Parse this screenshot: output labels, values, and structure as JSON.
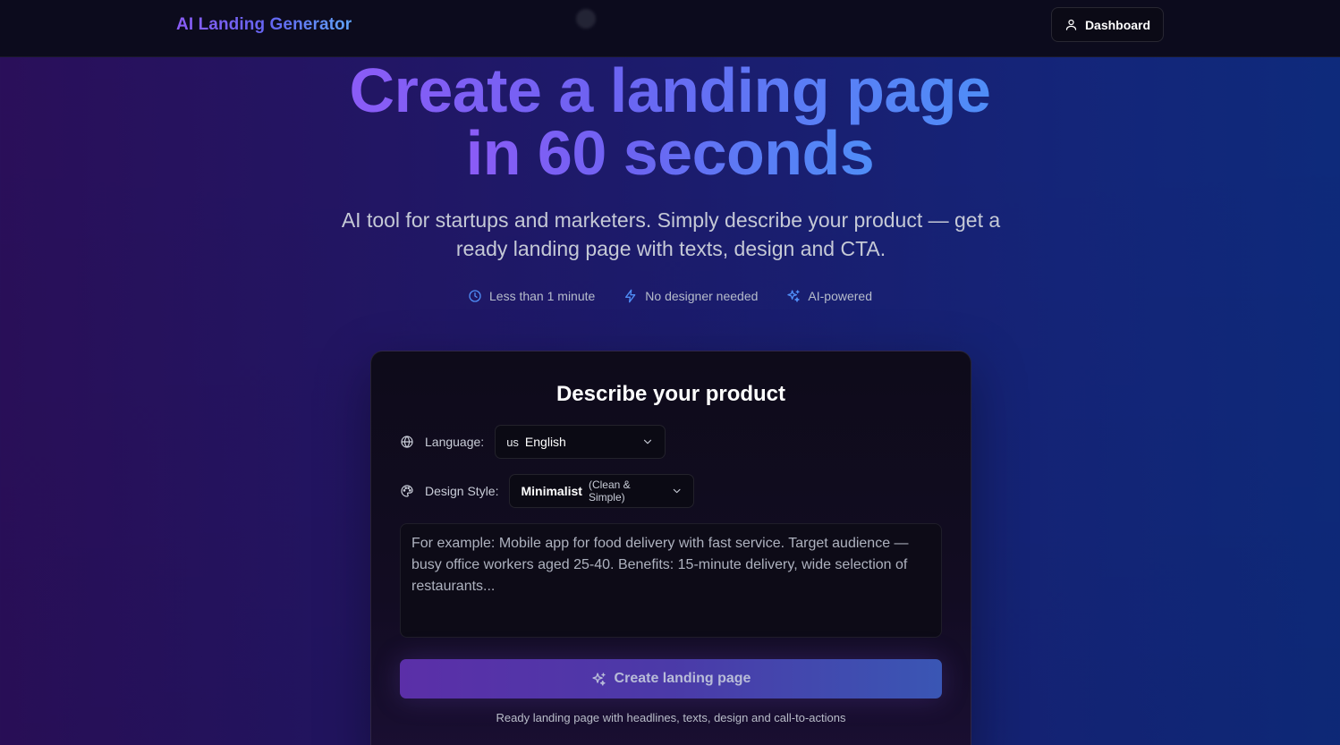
{
  "header": {
    "brand": "AI Landing Generator",
    "dashboard_label": "Dashboard"
  },
  "hero": {
    "title_line1": "Create a landing page",
    "title_line2": "in 60 seconds",
    "subtitle": "AI tool for startups and marketers. Simply describe your product — get a ready landing page with texts, design and CTA.",
    "features": [
      {
        "icon": "clock-icon",
        "label": "Less than 1 minute"
      },
      {
        "icon": "lightning-icon",
        "label": "No designer needed"
      },
      {
        "icon": "sparkles-icon",
        "label": "AI-powered"
      }
    ]
  },
  "form": {
    "title": "Describe your product",
    "language_label": "Language:",
    "language_code": "us",
    "language_value": "English",
    "style_label": "Design Style:",
    "style_value": "Minimalist",
    "style_hint": "(Clean & Simple)",
    "description_placeholder": "For example: Mobile app for food delivery with fast service. Target audience — busy office workers aged 25-40. Benefits: 15-minute delivery, wide selection of restaurants...",
    "description_value": "",
    "submit_label": "Create landing page",
    "submit_note": "Ready landing page with headlines, texts, design and call-to-actions"
  },
  "colors": {
    "accent_purple": "#8b5cf6",
    "accent_blue": "#4f8df7"
  }
}
